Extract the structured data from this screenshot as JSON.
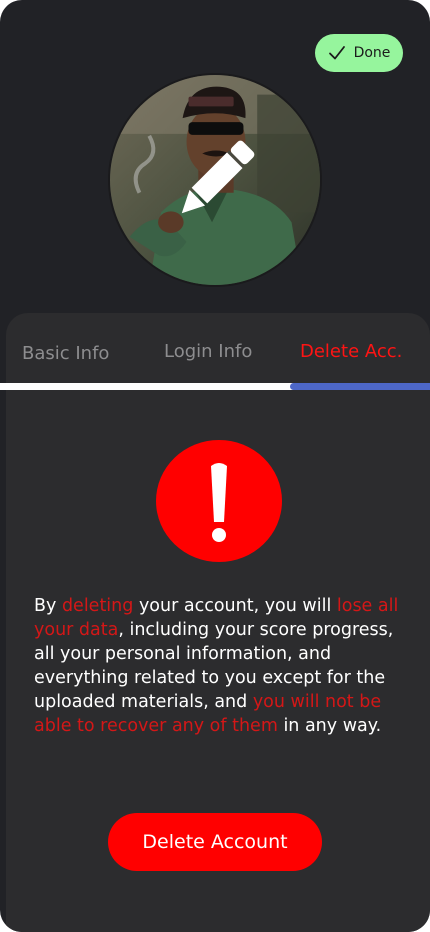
{
  "header": {
    "done_label": "Done",
    "done_icon": "check-icon"
  },
  "profile": {
    "avatar_alt": "profile-photo",
    "edit_icon": "pencil-icon"
  },
  "tabs": [
    {
      "label": "Basic Info",
      "active": false
    },
    {
      "label": "Login Info",
      "active": false
    },
    {
      "label": "Delete Acc.",
      "active": true
    }
  ],
  "progress": {
    "fraction": 0.326
  },
  "warning": {
    "icon": "exclamation-icon",
    "parts": [
      {
        "text": "By ",
        "highlight": false
      },
      {
        "text": "deleting",
        "highlight": true
      },
      {
        "text": " your account, you will ",
        "highlight": false
      },
      {
        "text": "lose all your data",
        "highlight": true
      },
      {
        "text": ", including your score progress, all your personal information, and everything related to you except for the uploaded materials, and ",
        "highlight": false
      },
      {
        "text": "you will not be able to recover any of them",
        "highlight": true
      },
      {
        "text": " in any way.",
        "highlight": false
      }
    ]
  },
  "delete_button": {
    "label": "Delete Account"
  },
  "colors": {
    "accent_red": "#ff0000",
    "highlight_red": "#d41717",
    "done_green": "#96f59d",
    "progress_blue": "#4d67c7",
    "background": "#212226",
    "panel": "#2c2c2e"
  }
}
